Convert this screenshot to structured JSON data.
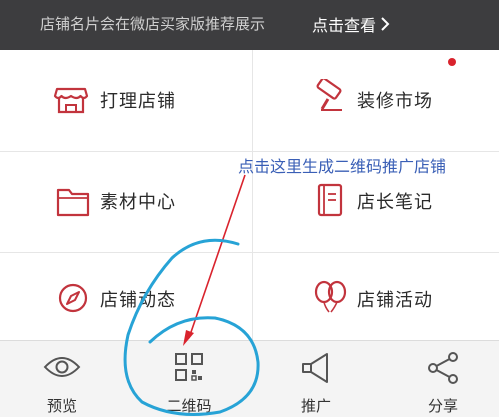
{
  "banner": {
    "text": "店铺名片会在微店买家版推荐展示",
    "link_label": "点击查看"
  },
  "menu": [
    {
      "label": "打理店铺",
      "icon": "shop-icon"
    },
    {
      "label": "装修市场",
      "icon": "paint-roller-icon",
      "badge": "red-dot"
    },
    {
      "label": "素材中心",
      "icon": "folder-icon"
    },
    {
      "label": "店长笔记",
      "icon": "notebook-icon"
    },
    {
      "label": "店铺动态",
      "icon": "compass-icon"
    },
    {
      "label": "店铺活动",
      "icon": "balloons-icon"
    }
  ],
  "annotation": {
    "text": "点击这里生成二维码推广店铺"
  },
  "tabbar": [
    {
      "label": "预览",
      "icon": "eye-icon"
    },
    {
      "label": "二维码",
      "icon": "qr-code-icon"
    },
    {
      "label": "推广",
      "icon": "megaphone-icon"
    },
    {
      "label": "分享",
      "icon": "share-icon"
    }
  ],
  "colors": {
    "banner_bg": "#3d3d3f",
    "icon_red": "#c2343d",
    "annotation_blue": "#3a5fb6",
    "circle_cyan": "#27a3d6",
    "arrow_red": "#d9232d"
  }
}
